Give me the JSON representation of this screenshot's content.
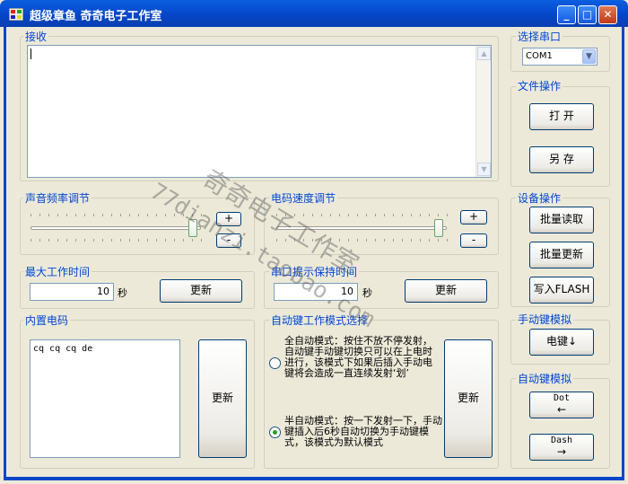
{
  "window": {
    "title": "超级章鱼  奇奇电子工作室",
    "minimize": "_",
    "maximize": "□",
    "close": "✕"
  },
  "receive": {
    "label": "接收",
    "text": ""
  },
  "serial": {
    "label": "选择串口",
    "selected": "COM1"
  },
  "file": {
    "label": "文件操作",
    "open": "打 开",
    "saveas": "另 存"
  },
  "device": {
    "label": "设备操作",
    "batch_read": "批量读取",
    "batch_update": "批量更新",
    "write_flash": "写入FLASH"
  },
  "sound_freq": {
    "label": "声音频率调节",
    "plus": "+",
    "minus": "-",
    "value_fraction": 0.98
  },
  "code_speed": {
    "label": "电码速度调节",
    "plus": "+",
    "minus": "-",
    "value_fraction": 0.98
  },
  "max_work": {
    "label": "最大工作时间",
    "value": "10",
    "unit": "秒",
    "update": "更新"
  },
  "port_hold": {
    "label": "串口提示保持时间",
    "value": "10",
    "unit": "秒",
    "update": "更新"
  },
  "builtin_code": {
    "label": "内置电码",
    "text": "cq cq cq de",
    "update": "更新"
  },
  "auto_mode": {
    "label": "自动键工作模式选择",
    "full_auto": "全自动模式：按住不放不停发射，自动键手动键切换只可以在上电时进行，该模式下如果后插入手动电键将会造成一直连续发射‘划’",
    "full_auto_checked": false,
    "semi_auto": "半自动模式：按一下发射一下，手动键插入后6秒自动切换为手动键模式，该模式为默认模式",
    "semi_auto_checked": true,
    "update": "更新"
  },
  "manual_sim": {
    "label": "手动键模拟",
    "key": "电键↓"
  },
  "auto_sim": {
    "label": "自动键模拟",
    "dot_label": "Dot",
    "dot_arrow": "←",
    "dash_label": "Dash",
    "dash_arrow": "→"
  },
  "watermark": {
    "line1": "奇奇电子工作室",
    "line2": "77dianzi.taobao.com"
  }
}
